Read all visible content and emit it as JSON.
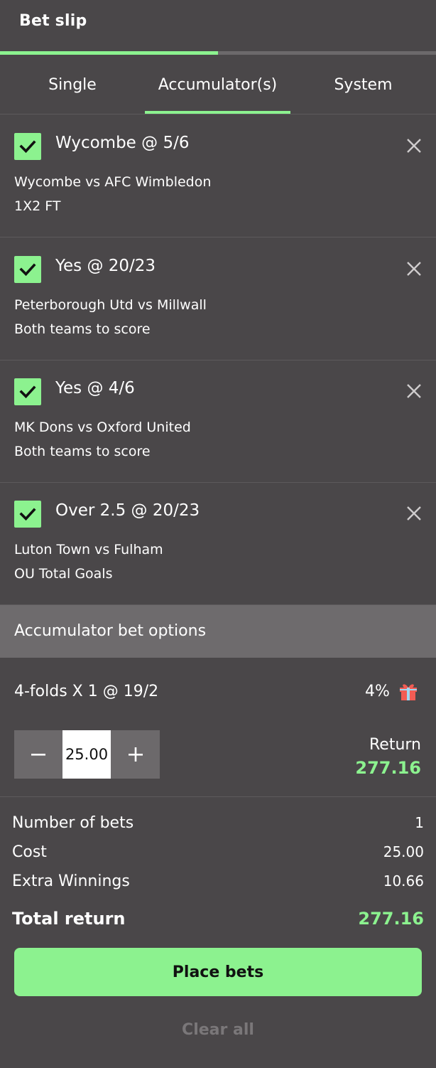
{
  "header": {
    "title": "Bet slip",
    "progress_fraction": 0.5
  },
  "tabs": [
    {
      "label": "Single",
      "active": false
    },
    {
      "label": "Accumulator(s)",
      "active": true
    },
    {
      "label": "System",
      "active": false
    }
  ],
  "selections": [
    {
      "title": "Wycombe @ 5/6",
      "match": "Wycombe vs AFC Wimbledon",
      "market": "1X2 FT",
      "checked": true
    },
    {
      "title": "Yes @ 20/23",
      "match": "Peterborough Utd vs Millwall",
      "market": "Both teams to score",
      "checked": true
    },
    {
      "title": "Yes @ 4/6",
      "match": "MK Dons vs Oxford United",
      "market": "Both teams to score",
      "checked": true
    },
    {
      "title": "Over 2.5 @ 20/23",
      "match": "Luton Town vs Fulham",
      "market": "OU Total Goals",
      "checked": true
    }
  ],
  "options": {
    "label": "Accumulator bet options",
    "fold_line": "4-folds  X  1  @  19/2",
    "bonus_percent": "4%",
    "bonus_icon": "gift-icon",
    "stake_value": "25.00",
    "return_label": "Return",
    "return_value": "277.16"
  },
  "summary": {
    "number_of_bets_label": "Number of bets",
    "number_of_bets_value": "1",
    "cost_label": "Cost",
    "cost_value": "25.00",
    "extra_winnings_label": "Extra Winnings",
    "extra_winnings_value": "10.66",
    "total_return_label": "Total return",
    "total_return_value": "277.16"
  },
  "actions": {
    "place_bets_label": "Place bets",
    "clear_all_label": "Clear all"
  },
  "colors": {
    "accent": "#8cf28f",
    "background": "#4a4749",
    "options_bar": "#6e6b6d"
  }
}
